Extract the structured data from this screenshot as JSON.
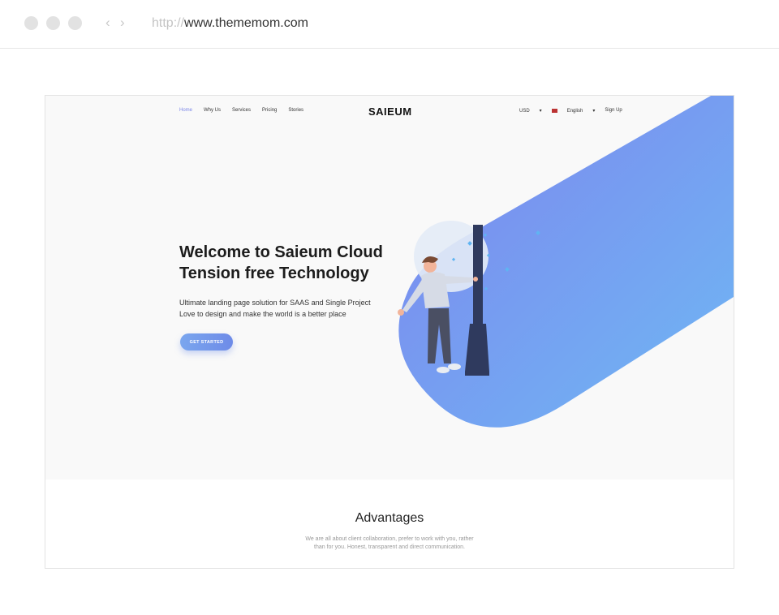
{
  "browser": {
    "url_protocol": "http://",
    "url_host": "www.thememom.com"
  },
  "nav": {
    "items": [
      "Home",
      "Why Us",
      "Services",
      "Pricing",
      "Stories"
    ],
    "brand": "SAIEUM",
    "currency": "USD",
    "language": "English",
    "signup": "Sign Up"
  },
  "hero": {
    "title_line1": "Welcome to Saieum Cloud",
    "title_line2": "Tension free Technology",
    "sub_line1": "Ultimate landing page solution for SAAS and Single Project",
    "sub_line2": "Love to design and make the world is a better place",
    "cta": "GET STARTED"
  },
  "advantages": {
    "title": "Advantages",
    "text_line1": "We are all about client collaboration, prefer to work with you, rather",
    "text_line2": "than for you. Honest, transparent and direct communication."
  },
  "colors": {
    "accent": "#7b86e8",
    "gradient_start": "#7d8ff0",
    "gradient_end": "#6fb3f3"
  }
}
